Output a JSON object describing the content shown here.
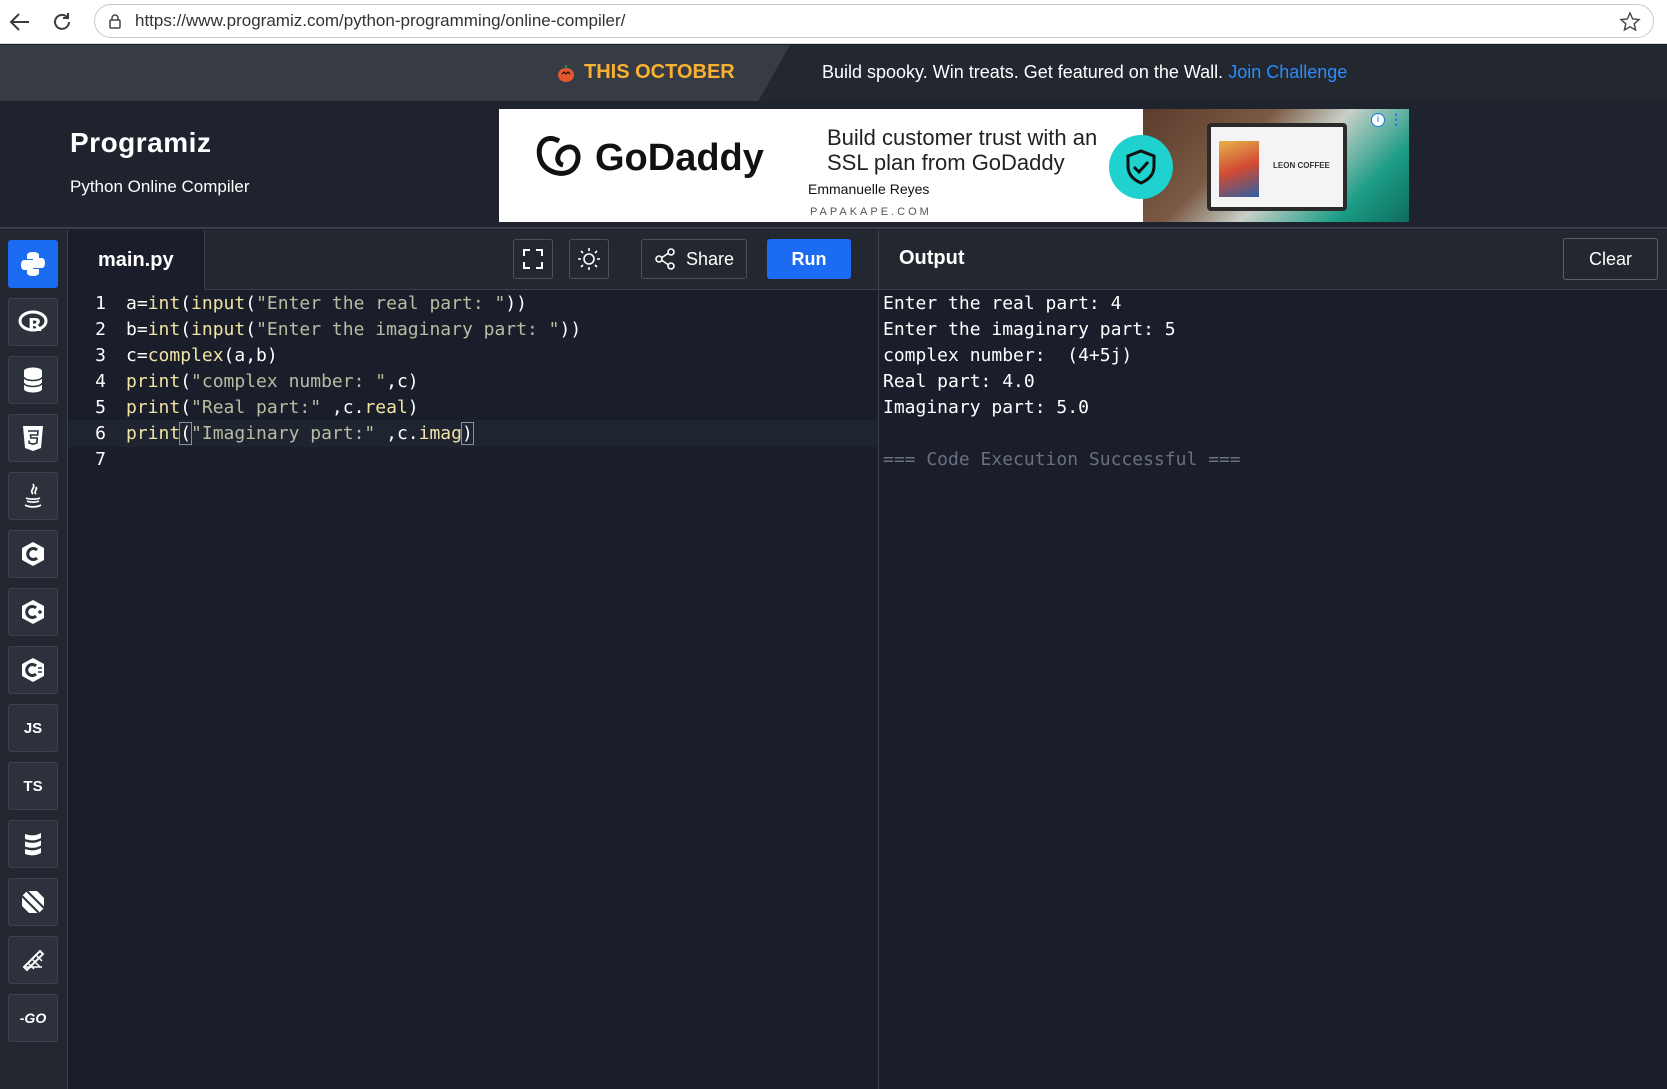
{
  "browser": {
    "url": "https://www.programiz.com/python-programming/online-compiler/"
  },
  "promo": {
    "tag": "THIS OCTOBER",
    "text": "Build spooky. Win treats. Get featured on the Wall.",
    "link": "Join Challenge"
  },
  "header": {
    "logo": "Programiz",
    "subtitle": "Python Online Compiler"
  },
  "ad": {
    "brand": "GoDaddy",
    "headline": "Build customer trust with an SSL plan from GoDaddy",
    "person": "Emmanuelle Reyes",
    "domain": "PAPAKAPE.COM",
    "laptop_text": "LEON COFFEE"
  },
  "sidebar": {
    "languages": [
      {
        "name": "python-icon",
        "label": ""
      },
      {
        "name": "r-icon",
        "label": ""
      },
      {
        "name": "sql-icon",
        "label": ""
      },
      {
        "name": "html5-icon",
        "label": ""
      },
      {
        "name": "java-icon",
        "label": ""
      },
      {
        "name": "c-icon",
        "label": ""
      },
      {
        "name": "cpp-icon",
        "label": ""
      },
      {
        "name": "csharp-icon",
        "label": ""
      },
      {
        "name": "javascript-icon",
        "label": "JS"
      },
      {
        "name": "typescript-icon",
        "label": "TS"
      },
      {
        "name": "scala-icon",
        "label": ""
      },
      {
        "name": "dart-icon",
        "label": ""
      },
      {
        "name": "rust-icon",
        "label": ""
      },
      {
        "name": "go-icon",
        "label": "-GO"
      }
    ]
  },
  "editor": {
    "filename": "main.py",
    "share_label": "Share",
    "run_label": "Run",
    "lines": [
      {
        "n": "1",
        "parts": [
          [
            "op",
            "a="
          ],
          [
            "kw",
            "int"
          ],
          [
            "op",
            "("
          ],
          [
            "kw",
            "input"
          ],
          [
            "op",
            "("
          ],
          [
            "str",
            "\"Enter the real part: \""
          ],
          [
            "op",
            "))"
          ]
        ]
      },
      {
        "n": "2",
        "parts": [
          [
            "op",
            "b="
          ],
          [
            "kw",
            "int"
          ],
          [
            "op",
            "("
          ],
          [
            "kw",
            "input"
          ],
          [
            "op",
            "("
          ],
          [
            "str",
            "\"Enter the imaginary part: \""
          ],
          [
            "op",
            "))"
          ]
        ]
      },
      {
        "n": "3",
        "parts": [
          [
            "op",
            "c="
          ],
          [
            "kw",
            "complex"
          ],
          [
            "op",
            "(a,b)"
          ]
        ]
      },
      {
        "n": "4",
        "parts": [
          [
            "kw",
            "print"
          ],
          [
            "op",
            "("
          ],
          [
            "str",
            "\"complex number: \""
          ],
          [
            "op",
            ",c)"
          ]
        ]
      },
      {
        "n": "5",
        "parts": [
          [
            "kw",
            "print"
          ],
          [
            "op",
            "("
          ],
          [
            "str",
            "\"Real part:\""
          ],
          [
            "op",
            " ,c."
          ],
          [
            "kw",
            "real"
          ],
          [
            "op",
            ")"
          ]
        ]
      },
      {
        "n": "6",
        "parts": [
          [
            "kw",
            "print"
          ],
          [
            "brk",
            "("
          ],
          [
            "str",
            "\"Imaginary part:\""
          ],
          [
            "op",
            " ,c."
          ],
          [
            "kw",
            "imag"
          ],
          [
            "brk",
            ")"
          ]
        ]
      },
      {
        "n": "7",
        "parts": []
      }
    ]
  },
  "output": {
    "title": "Output",
    "clear_label": "Clear",
    "lines": [
      "Enter the real part: 4",
      "Enter the imaginary part: 5",
      "complex number:  (4+5j)",
      "Real part: 4.0",
      "Imaginary part: 5.0",
      "",
      "=== Code Execution Successful ==="
    ]
  }
}
